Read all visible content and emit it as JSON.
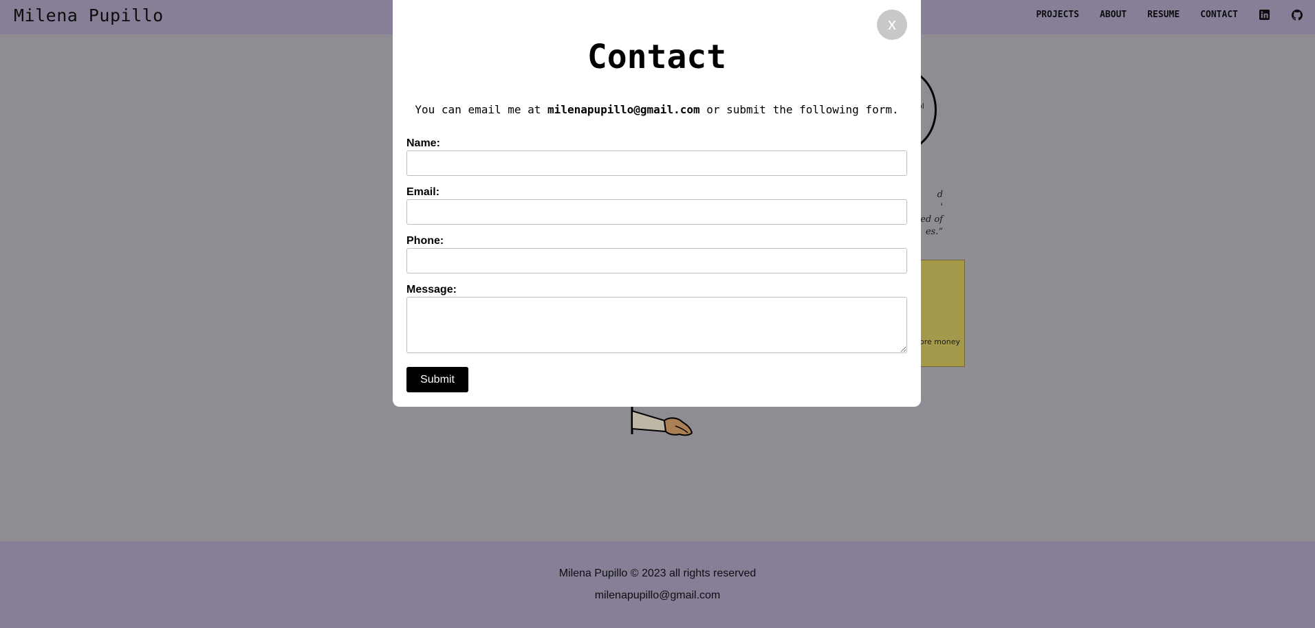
{
  "navbar": {
    "site_title": "Milena Pupillo",
    "links": [
      {
        "label": "PROJECTS"
      },
      {
        "label": "ABOUT"
      },
      {
        "label": "RESUME"
      },
      {
        "label": "CONTACT"
      }
    ],
    "icons": [
      "linkedin-icon",
      "github-icon"
    ]
  },
  "background": {
    "circle_text": "ol",
    "quote_lines": [
      "d",
      "'",
      "ed of",
      "es.”"
    ],
    "card_text": "ore money"
  },
  "modal": {
    "close_label": "x",
    "title": "Contact",
    "intro_prefix": "You can email me at ",
    "intro_email": "milenapupillo@gmail.com",
    "intro_suffix": " or submit the following form.",
    "fields": {
      "name_label": "Name:",
      "name_value": "",
      "email_label": "Email:",
      "email_value": "",
      "phone_label": "Phone:",
      "phone_value": "",
      "message_label": "Message:",
      "message_value": ""
    },
    "submit_label": "Submit"
  },
  "footer": {
    "copyright": "Milena Pupillo © 2023 all rights reserved",
    "email": "milenapupillo@gmail.com"
  },
  "colors": {
    "navbar_bg": "#a89fbd",
    "page_bg": "#b3b1b8",
    "modal_bg": "#ffffff",
    "close_button_bg": "#c8c8c8",
    "submit_bg": "#000000",
    "card_bg": "#cfc060"
  }
}
